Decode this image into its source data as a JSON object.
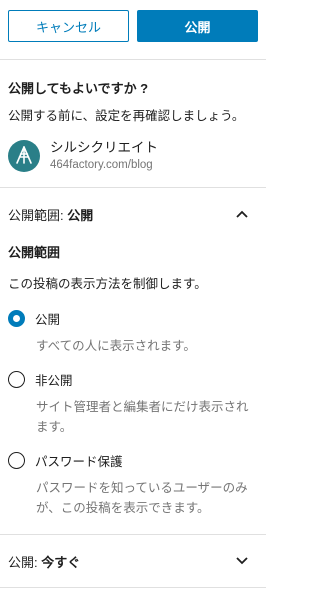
{
  "header": {
    "cancel_label": "キャンセル",
    "publish_label": "公開"
  },
  "intro": {
    "title": "公開してもよいですか ?",
    "text": "公開する前に、設定を再確認しましょう。",
    "site_name": "シルシクリエイト",
    "site_url": "464factory.com/blog"
  },
  "visibility": {
    "toggle_prefix": "公開範囲: ",
    "toggle_value": "公開",
    "heading": "公開範囲",
    "description": "この投稿の表示方法を制御します。",
    "options": [
      {
        "label": "公開",
        "help": "すべての人に表示されます。",
        "selected": true
      },
      {
        "label": "非公開",
        "help": "サイト管理者と編集者にだけ表示されます。",
        "selected": false
      },
      {
        "label": "パスワード保護",
        "help": "パスワードを知っているユーザーのみが、この投稿を表示できます。",
        "selected": false
      }
    ]
  },
  "schedule": {
    "toggle_prefix": "公開: ",
    "toggle_value": "今すぐ"
  },
  "colors": {
    "accent": "#007cba",
    "site_icon_bg": "#2a7f88",
    "muted_text": "#757575"
  },
  "icons": {
    "site": "site-logo-icon",
    "expanded": "chevron-up-icon",
    "collapsed": "chevron-down-icon"
  }
}
